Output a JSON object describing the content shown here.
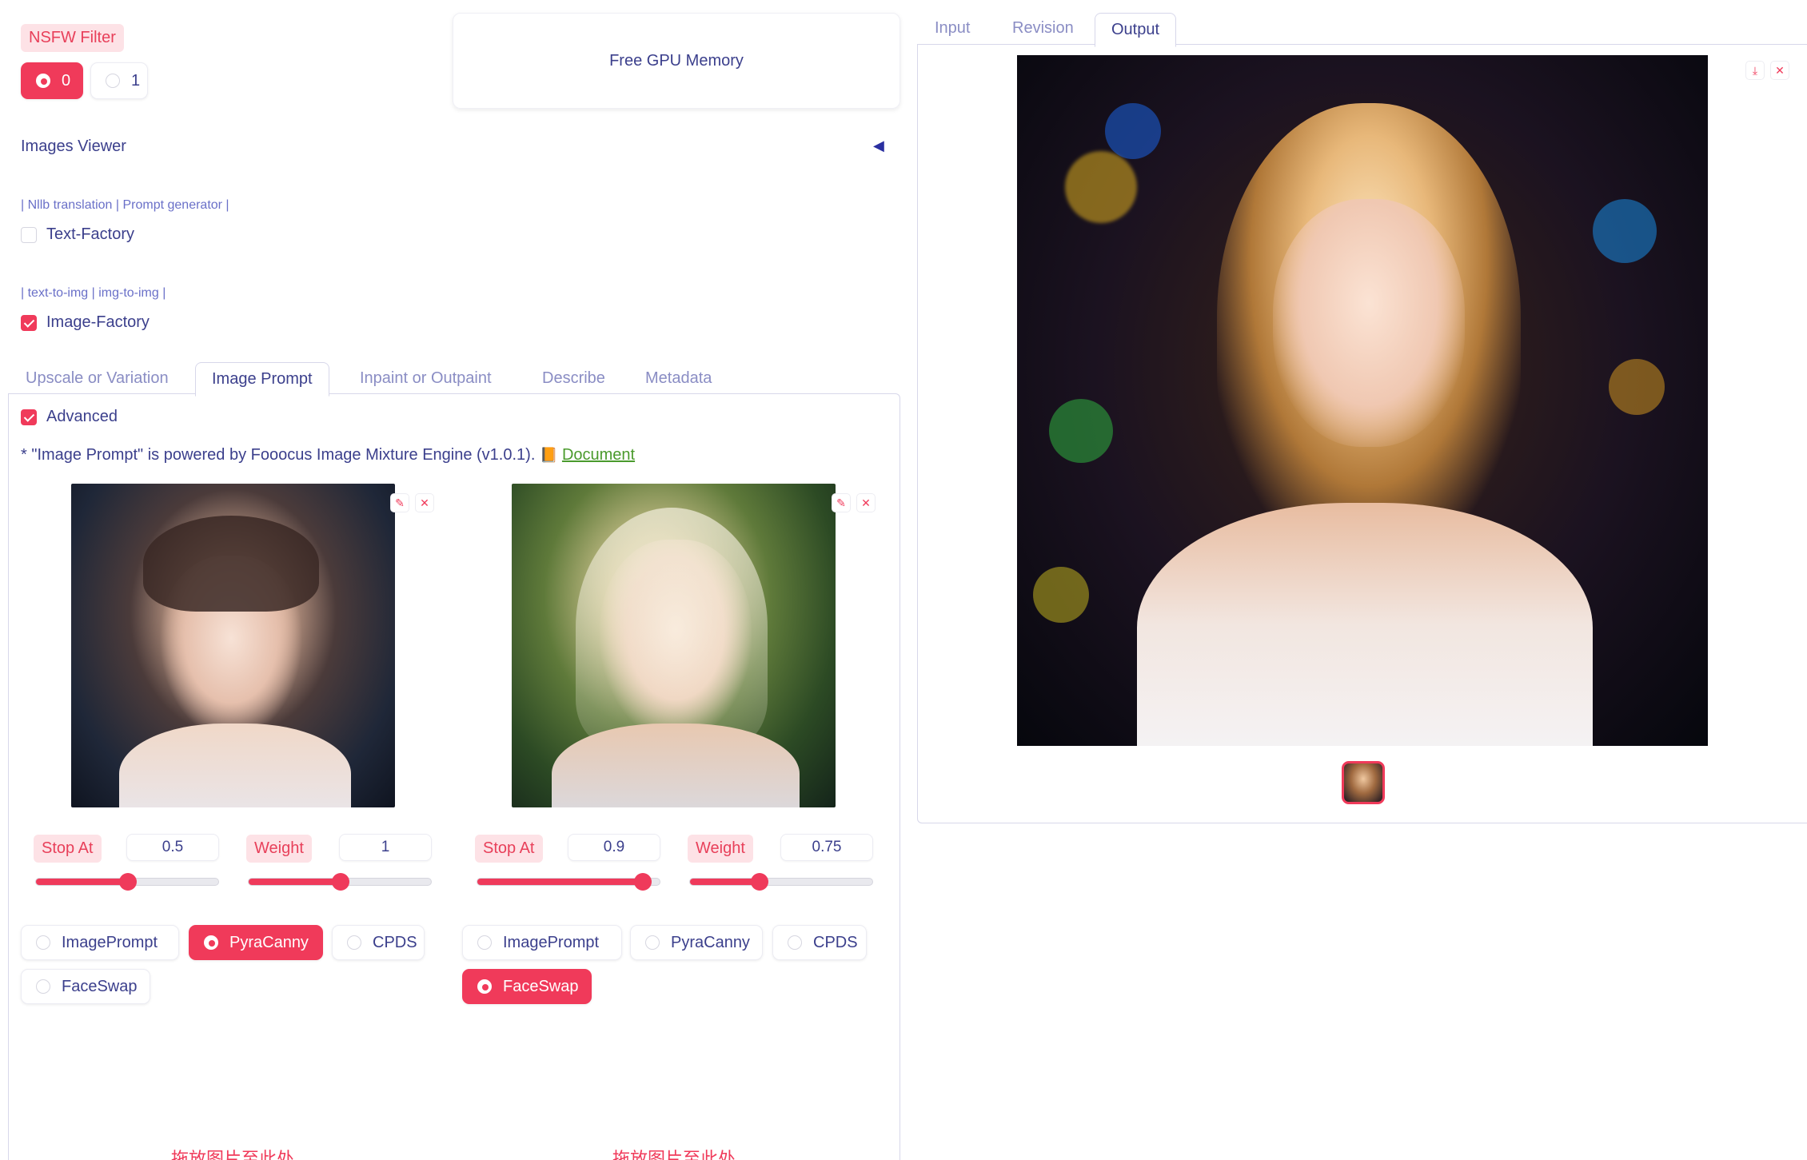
{
  "nsfw": {
    "label": "NSFW Filter",
    "options": [
      "0",
      "1"
    ],
    "selected": "0"
  },
  "gpu_button": "Free GPU Memory",
  "images_viewer": {
    "label": "Images Viewer",
    "toggle": "◀"
  },
  "text_factory": {
    "note": "| Nllb translation | Prompt generator |",
    "label": "Text-Factory",
    "checked": false
  },
  "image_factory": {
    "note": "| text-to-img | img-to-img |",
    "label": "Image-Factory",
    "checked": true
  },
  "left_tabs": [
    "Upscale or Variation",
    "Image Prompt",
    "Inpaint or Outpaint",
    "Describe",
    "Metadata"
  ],
  "left_active_tab": "Image Prompt",
  "advanced": {
    "label": "Advanced",
    "checked": true
  },
  "prompt_note": {
    "prefix": "* \"Image Prompt\" is powered by Fooocus Image Mixture Engine (v1.0.1).",
    "link": "Document",
    "link_icon": "📙"
  },
  "slots": [
    {
      "stop_label": "Stop At",
      "stop_value": "0.5",
      "stop_frac": 0.5,
      "weight_label": "Weight",
      "weight_value": "1",
      "weight_frac": 0.5,
      "types": [
        "ImagePrompt",
        "PyraCanny",
        "CPDS",
        "FaceSwap"
      ],
      "selected": "PyraCanny",
      "drop_hint": "拖放图片至此处"
    },
    {
      "stop_label": "Stop At",
      "stop_value": "0.9",
      "stop_frac": 0.9,
      "weight_label": "Weight",
      "weight_value": "0.75",
      "weight_frac": 0.375,
      "types": [
        "ImagePrompt",
        "PyraCanny",
        "CPDS",
        "FaceSwap"
      ],
      "selected": "FaceSwap",
      "drop_hint": "拖放图片至此处"
    }
  ],
  "right_tabs": [
    "Input",
    "Revision",
    "Output"
  ],
  "right_active_tab": "Output",
  "icons": {
    "edit": "pencil-icon",
    "clear": "close-icon",
    "download": "download-icon"
  },
  "colors": {
    "accent": "#f03a5a",
    "text": "#3b3f8c",
    "muted": "#8a8dc4"
  }
}
